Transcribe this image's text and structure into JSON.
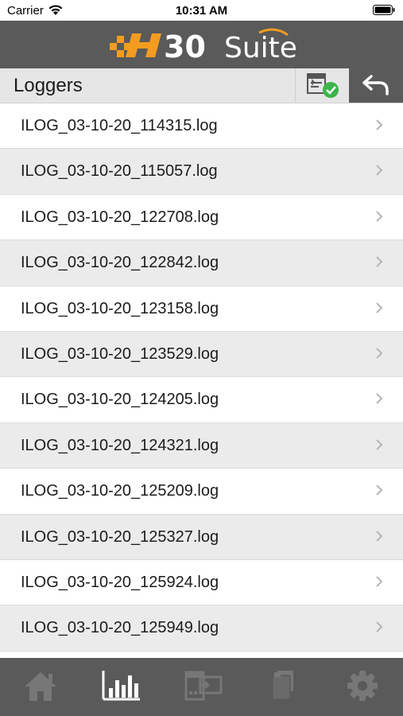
{
  "status_bar": {
    "carrier": "Carrier",
    "time": "10:31 AM"
  },
  "header": {
    "logo_text": "H30 Suite"
  },
  "toolbar": {
    "title": "Loggers",
    "sync_icon": "sync-check-icon",
    "back_icon": "back-arrow-icon"
  },
  "logs": [
    {
      "name": "ILOG_03-10-20_114315.log"
    },
    {
      "name": "ILOG_03-10-20_115057.log"
    },
    {
      "name": "ILOG_03-10-20_122708.log"
    },
    {
      "name": "ILOG_03-10-20_122842.log"
    },
    {
      "name": "ILOG_03-10-20_123158.log"
    },
    {
      "name": "ILOG_03-10-20_123529.log"
    },
    {
      "name": "ILOG_03-10-20_124205.log"
    },
    {
      "name": "ILOG_03-10-20_124321.log"
    },
    {
      "name": "ILOG_03-10-20_125209.log"
    },
    {
      "name": "ILOG_03-10-20_125327.log"
    },
    {
      "name": "ILOG_03-10-20_125924.log"
    },
    {
      "name": "ILOG_03-10-20_125949.log"
    }
  ],
  "tabs": [
    {
      "icon": "home-icon",
      "active": false
    },
    {
      "icon": "bar-chart-icon",
      "active": true
    },
    {
      "icon": "device-transfer-icon",
      "active": false
    },
    {
      "icon": "documents-icon",
      "active": false
    },
    {
      "icon": "gear-icon",
      "active": false
    }
  ],
  "colors": {
    "header_bg": "#5a5a5a",
    "accent_orange": "#f39c1f",
    "check_green": "#3cb44a",
    "tab_inactive": "#777777",
    "tab_active": "#ffffff"
  }
}
